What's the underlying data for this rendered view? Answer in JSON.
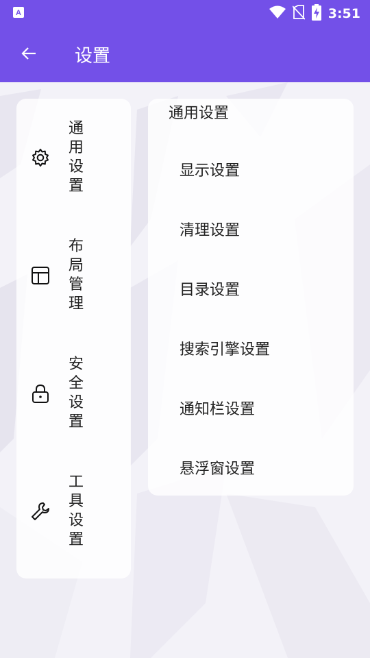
{
  "status_bar": {
    "time": "3:51",
    "icons": [
      "a-notification-icon",
      "wifi-icon",
      "no-sim-icon",
      "battery-charging-icon"
    ]
  },
  "app_bar": {
    "title": "设置",
    "back_icon": "arrow-left-icon"
  },
  "sidebar": {
    "items": [
      {
        "label": "通用设置",
        "chars": [
          "通",
          "用",
          "设",
          "置"
        ],
        "icon": "gear-icon"
      },
      {
        "label": "布局管理",
        "chars": [
          "布",
          "局",
          "管",
          "理"
        ],
        "icon": "layout-icon"
      },
      {
        "label": "安全设置",
        "chars": [
          "安",
          "全",
          "设",
          "置"
        ],
        "icon": "lock-icon"
      },
      {
        "label": "工具设置",
        "chars": [
          "工",
          "具",
          "设",
          "置"
        ],
        "icon": "wrench-icon"
      }
    ]
  },
  "main": {
    "section_title": "通用设置",
    "items": [
      "显示设置",
      "清理设置",
      "目录设置",
      "搜索引擎设置",
      "通知栏设置",
      "悬浮窗设置"
    ]
  },
  "colors": {
    "primary": "#7350e8",
    "background": "#f3f2f8",
    "text": "#222222"
  }
}
